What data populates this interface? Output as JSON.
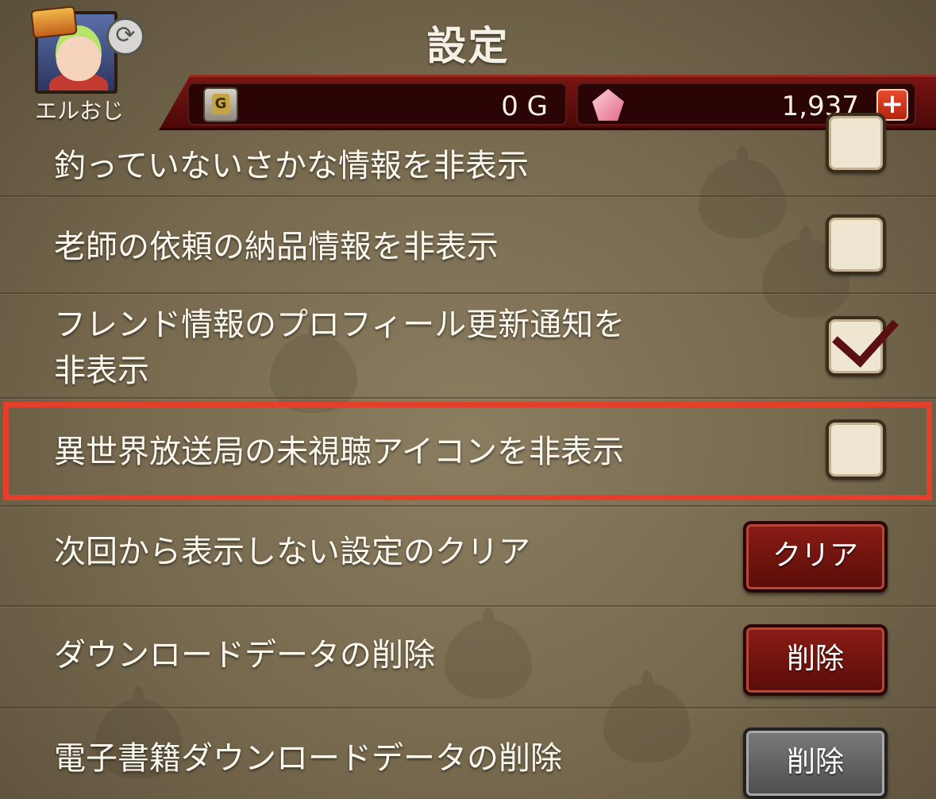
{
  "header": {
    "title": "設定",
    "player_name": "エルおじ",
    "gold_value": "0 G",
    "gems_value": "1,937",
    "gold_icon_letter": "G",
    "plus_label": "+",
    "sync_glyph": "⟳"
  },
  "settings": [
    {
      "label": "釣っていないさかな情報を非表示",
      "type": "checkbox",
      "checked": false
    },
    {
      "label": "老師の依頼の納品情報を非表示",
      "type": "checkbox",
      "checked": false
    },
    {
      "label_line1": "フレンド情報のプロフィール更新通知を",
      "label_line2": "非表示",
      "type": "checkbox",
      "checked": true
    },
    {
      "label": "異世界放送局の未視聴アイコンを非表示",
      "type": "checkbox",
      "checked": false,
      "highlighted": true
    },
    {
      "label": "次回から表示しない設定のクリア",
      "type": "button",
      "button_label": "クリア",
      "button_color": "red"
    },
    {
      "label": "ダウンロードデータの削除",
      "type": "button",
      "button_label": "削除",
      "button_color": "red"
    },
    {
      "label": "電子書籍ダウンロードデータの削除",
      "type": "button",
      "button_label": "削除",
      "button_color": "gray"
    }
  ],
  "colors": {
    "highlight": "#e2402a",
    "header_bar": "#7a1414",
    "button_red": "#8a1d16",
    "button_gray": "#6a6a6a",
    "check_mark": "#5a1010"
  }
}
